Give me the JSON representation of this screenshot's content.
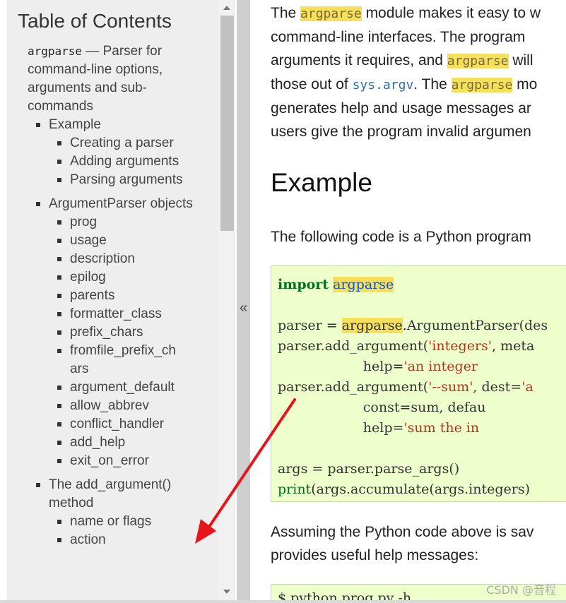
{
  "sidebar": {
    "title": "Table of Contents",
    "root_code": "argparse",
    "root_text": " — Parser for command-line options, arguments and sub-commands",
    "sections": [
      {
        "label": "Example",
        "items": [
          "Creating a parser",
          "Adding arguments",
          "Parsing arguments"
        ]
      },
      {
        "label": "ArgumentParser objects",
        "items": [
          "prog",
          "usage",
          "description",
          "epilog",
          "parents",
          "formatter_class",
          "prefix_chars",
          "fromfile_prefix_chars",
          "argument_default",
          "allow_abbrev",
          "conflict_handler",
          "add_help",
          "exit_on_error"
        ]
      },
      {
        "label": "The add_argument() method",
        "items": [
          "name or flags",
          "action"
        ]
      }
    ],
    "collapse_glyph": "«"
  },
  "main": {
    "intro": {
      "l1_a": "The ",
      "l1_b": "argparse",
      "l1_c": " module makes it easy to w",
      "l2": "command-line interfaces. The program",
      "l3_a": "arguments it requires, and ",
      "l3_b": "argparse",
      "l3_c": " will",
      "l4_a": "those out of ",
      "l4_b": "sys.argv",
      "l4_c": ". The ",
      "l4_d": "argparse",
      "l4_e": " mo",
      "l5": "generates help and usage messages ar",
      "l6": "users give the program invalid argumen"
    },
    "heading": "Example",
    "following": "The following code is a Python program",
    "code": {
      "l1_kw": "import",
      "l1_mod": "argparse",
      "l3_a": "parser = ",
      "l3_b": "argparse",
      "l3_c": ".ArgumentParser(des",
      "l4_a": "parser.add_argument(",
      "l4_b": "'integers'",
      "l4_c": ", meta",
      "l5_a": "                    help=",
      "l5_b": "'an integer",
      "l6_a": "parser.add_argument(",
      "l6_b": "'--sum'",
      "l6_c": ", dest=",
      "l6_d": "'a",
      "l7": "                    const=sum, defau",
      "l8_a": "                    help=",
      "l8_b": "'sum the in",
      "l10": "args = parser.parse_args()",
      "l11_a": "print",
      "l11_b": "(args.accumulate(args.integers)"
    },
    "assuming_l1": "Assuming the Python code above is sav",
    "assuming_l2": "provides useful help messages:",
    "code2": "$ python prog.py -h"
  },
  "watermark": "CSDN @音程",
  "colors": {
    "highlight": "#f6e05b",
    "code_bg": "#eeffcc",
    "arrow": "#e8141b"
  }
}
